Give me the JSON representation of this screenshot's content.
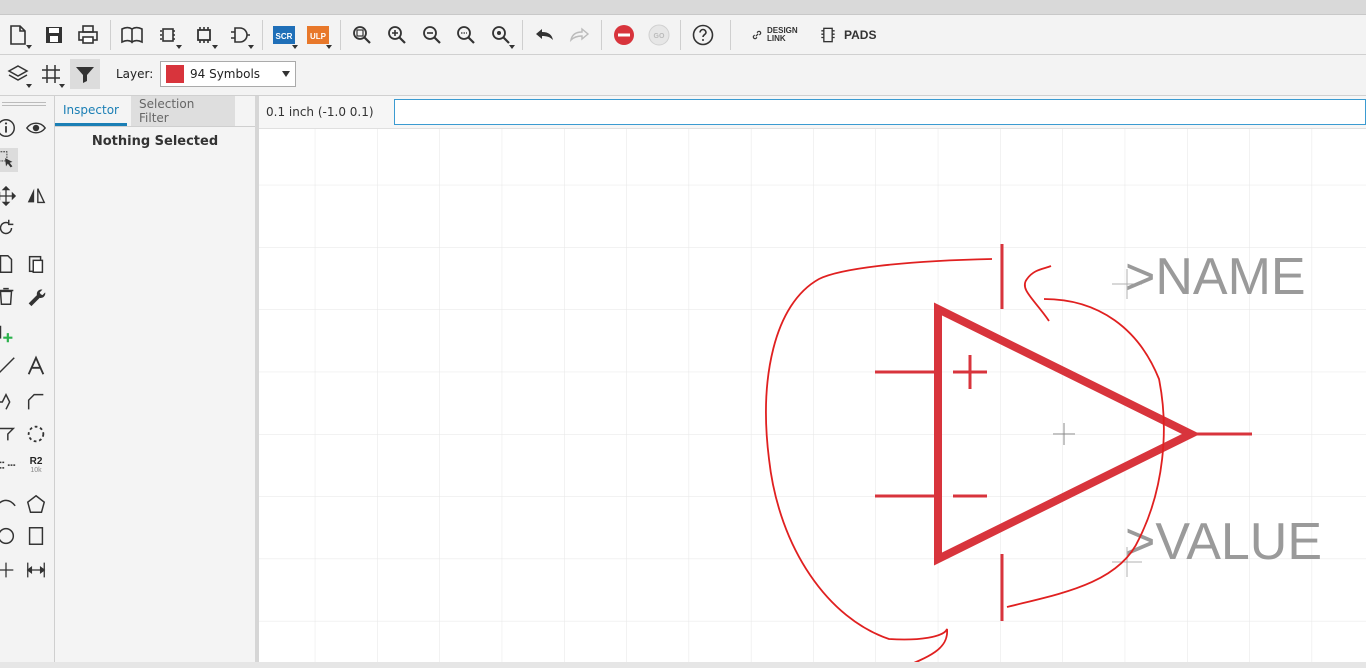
{
  "toolbar": {
    "scr_label": "SCR",
    "ulp_label": "ULP",
    "design_link_line1": "DESIGN",
    "design_link_line2": "LINK",
    "pads_label": "PADS"
  },
  "layerbar": {
    "layer_label": "Layer:",
    "selected_layer": "94 Symbols",
    "layer_color": "#d8343c"
  },
  "leftbar": {
    "r2_label": "R2",
    "r2_sub": "10k"
  },
  "inspector": {
    "tabs": [
      {
        "label": "Inspector",
        "active": true
      },
      {
        "label": "Selection Filter",
        "active": false
      }
    ],
    "empty_text": "Nothing Selected"
  },
  "commandbar": {
    "grid_info": "0.1 inch (-1.0 0.1)",
    "command_value": ""
  },
  "canvas": {
    "name_label": ">NAME",
    "value_label": ">VALUE",
    "plus_sign": "+",
    "minus_sign": "−",
    "symbol_color": "#d8343c",
    "text_color": "#9a9a9a",
    "annotation_color": "#e02020"
  }
}
